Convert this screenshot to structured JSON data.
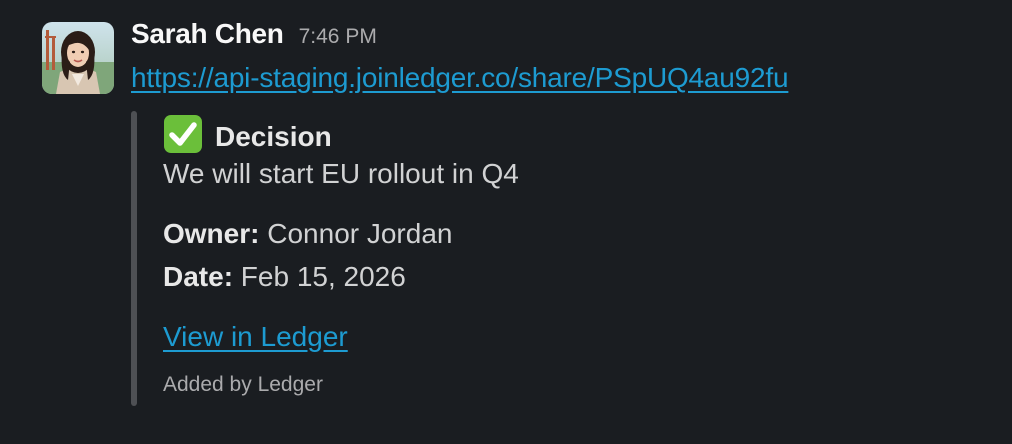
{
  "message": {
    "sender": "Sarah Chen",
    "timestamp": "7:46 PM",
    "link": "https://api-staging.joinledger.co/share/PSpUQ4au92fu"
  },
  "attachment": {
    "title_icon": "check-mark-icon",
    "title": "Decision",
    "text": "We will start EU rollout in Q4",
    "fields": [
      {
        "label": "Owner:",
        "value": "Connor Jordan"
      },
      {
        "label": "Date:",
        "value": "Feb 15, 2026"
      }
    ],
    "action_link": "View in Ledger",
    "footer": "Added by Ledger"
  },
  "colors": {
    "background": "#1a1d21",
    "link": "#1d9bd1",
    "attachment_bar": "#4e5054",
    "check_green": "#6bbf3a"
  }
}
